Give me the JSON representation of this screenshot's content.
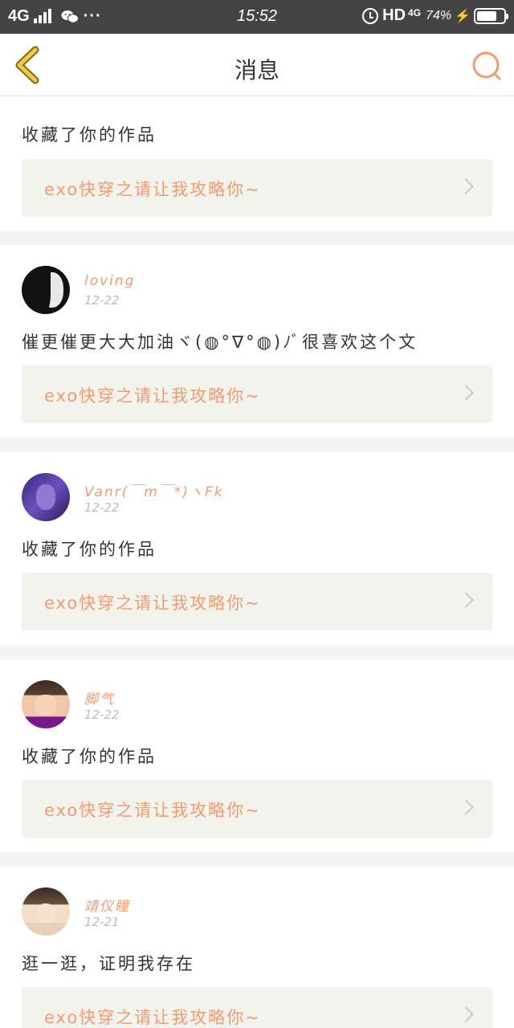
{
  "status_bar": {
    "network": "4G",
    "dots": "···",
    "time": "15:52",
    "hd": "HD",
    "network2": "4G",
    "battery_percent_label": "74%",
    "battery_level": 0.74
  },
  "header": {
    "title": "消息",
    "back_icon": "chevron-left-icon",
    "search_icon": "search-icon"
  },
  "colors": {
    "accent": "#f29b6e",
    "back_yellow": "#f5c842",
    "link_bg": "#f3f3ee"
  },
  "messages": [
    {
      "username": "",
      "date": "",
      "text": "收藏了你的作品",
      "work_title": "exo快穿之请让我攻略你~"
    },
    {
      "username": "loving",
      "date": "12-22",
      "text": "催更催更大大加油ヾ(◍°∇°◍)ﾉﾞ很喜欢这个文",
      "work_title": "exo快穿之请让我攻略你~"
    },
    {
      "username": "Vanr(￣m￣*)ヽFk",
      "date": "12-22",
      "text": "收藏了你的作品",
      "work_title": "exo快穿之请让我攻略你~"
    },
    {
      "username": "脚气",
      "date": "12-22",
      "text": "收藏了你的作品",
      "work_title": "exo快穿之请让我攻略你~"
    },
    {
      "username": "靖仪瞳",
      "date": "12-21",
      "text": "逛一逛，证明我存在",
      "work_title": "exo快穿之请让我攻略你~"
    }
  ]
}
